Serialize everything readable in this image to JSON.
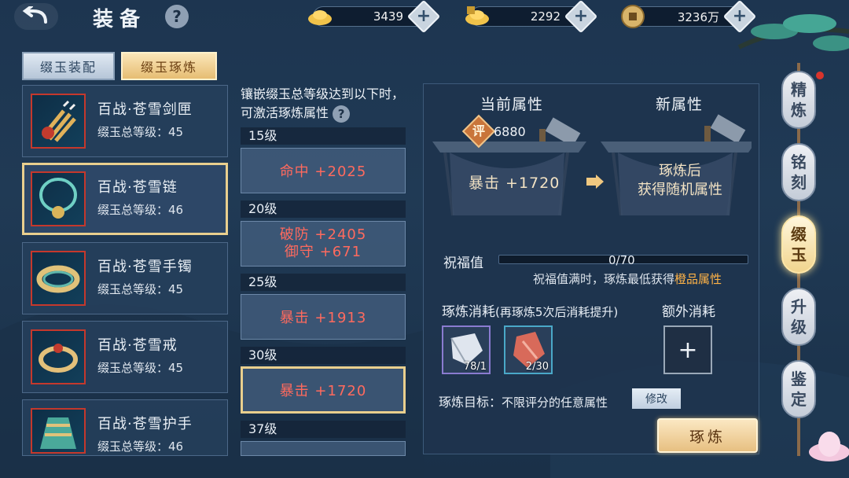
{
  "header": {
    "title": "装备",
    "help": "?"
  },
  "currencies": [
    {
      "icon": "gold-ingot-icon",
      "value": "3439",
      "plus": "+"
    },
    {
      "icon": "bound-gold-ingot-icon",
      "value": "2292",
      "plus": "+"
    },
    {
      "icon": "copper-coin-icon",
      "value": "3236万",
      "plus": "+"
    }
  ],
  "tabs": [
    {
      "label": "缀玉装配"
    },
    {
      "label": "缀玉琢炼"
    }
  ],
  "items": [
    {
      "name": "百战·苍雪剑匣",
      "level": "缀玉总等级：45"
    },
    {
      "name": "百战·苍雪链",
      "level": "缀玉总等级：46"
    },
    {
      "name": "百战·苍雪手镯",
      "level": "缀玉总等级：45"
    },
    {
      "name": "百战·苍雪戒",
      "level": "缀玉总等级：45"
    },
    {
      "name": "百战·苍雪护手",
      "level": "缀玉总等级：46"
    }
  ],
  "middle": {
    "description": "镶嵌缀玉总等级达到以下时，可激活琢炼属性",
    "help": "?",
    "levels": [
      {
        "label": "15级",
        "attrs": [
          "命中 +2025"
        ]
      },
      {
        "label": "20级",
        "attrs": [
          "破防 +2405",
          "御守 +671"
        ]
      },
      {
        "label": "25级",
        "attrs": [
          "暴击 +1913"
        ]
      },
      {
        "label": "30级",
        "attrs": [
          "暴击 +1720"
        ]
      },
      {
        "label": "37级",
        "attrs": []
      }
    ]
  },
  "panel": {
    "current_header": "当前属性",
    "new_header": "新属性",
    "score_badge": "评",
    "score": "6880",
    "current_attr": "暴击 +1720",
    "new_attr_line1": "琢炼后",
    "new_attr_line2": "获得随机属性",
    "bless_label": "祝福值",
    "bless_value": "0/70",
    "bless_progress": 0.0,
    "bless_note_prefix": "祝福值满时，琢炼最低获得",
    "bless_note_highlight": "橙品属性",
    "cost_label": "琢炼消耗",
    "cost_note": "(再琢炼5次后消耗提升)",
    "extra_label": "额外消耗",
    "materials": [
      {
        "icon": "silver-stone-icon",
        "count": "78/1"
      },
      {
        "icon": "red-crystal-icon",
        "count": "2/30"
      }
    ],
    "extra_plus": "+",
    "target_label": "琢炼目标：",
    "target_value": "不限评分的任意属性",
    "modify": "修改",
    "refine": "琢炼"
  },
  "side_nav": [
    {
      "label": "精炼",
      "active": false
    },
    {
      "label": "铭刻",
      "active": false
    },
    {
      "label": "缀玉",
      "active": true
    },
    {
      "label": "升级",
      "active": false
    },
    {
      "label": "鉴定",
      "active": false
    }
  ],
  "colors": {
    "accent_gold": "#e9cf8e",
    "attr_red": "#ff6a5e",
    "highlight_orange": "#ffb347"
  }
}
